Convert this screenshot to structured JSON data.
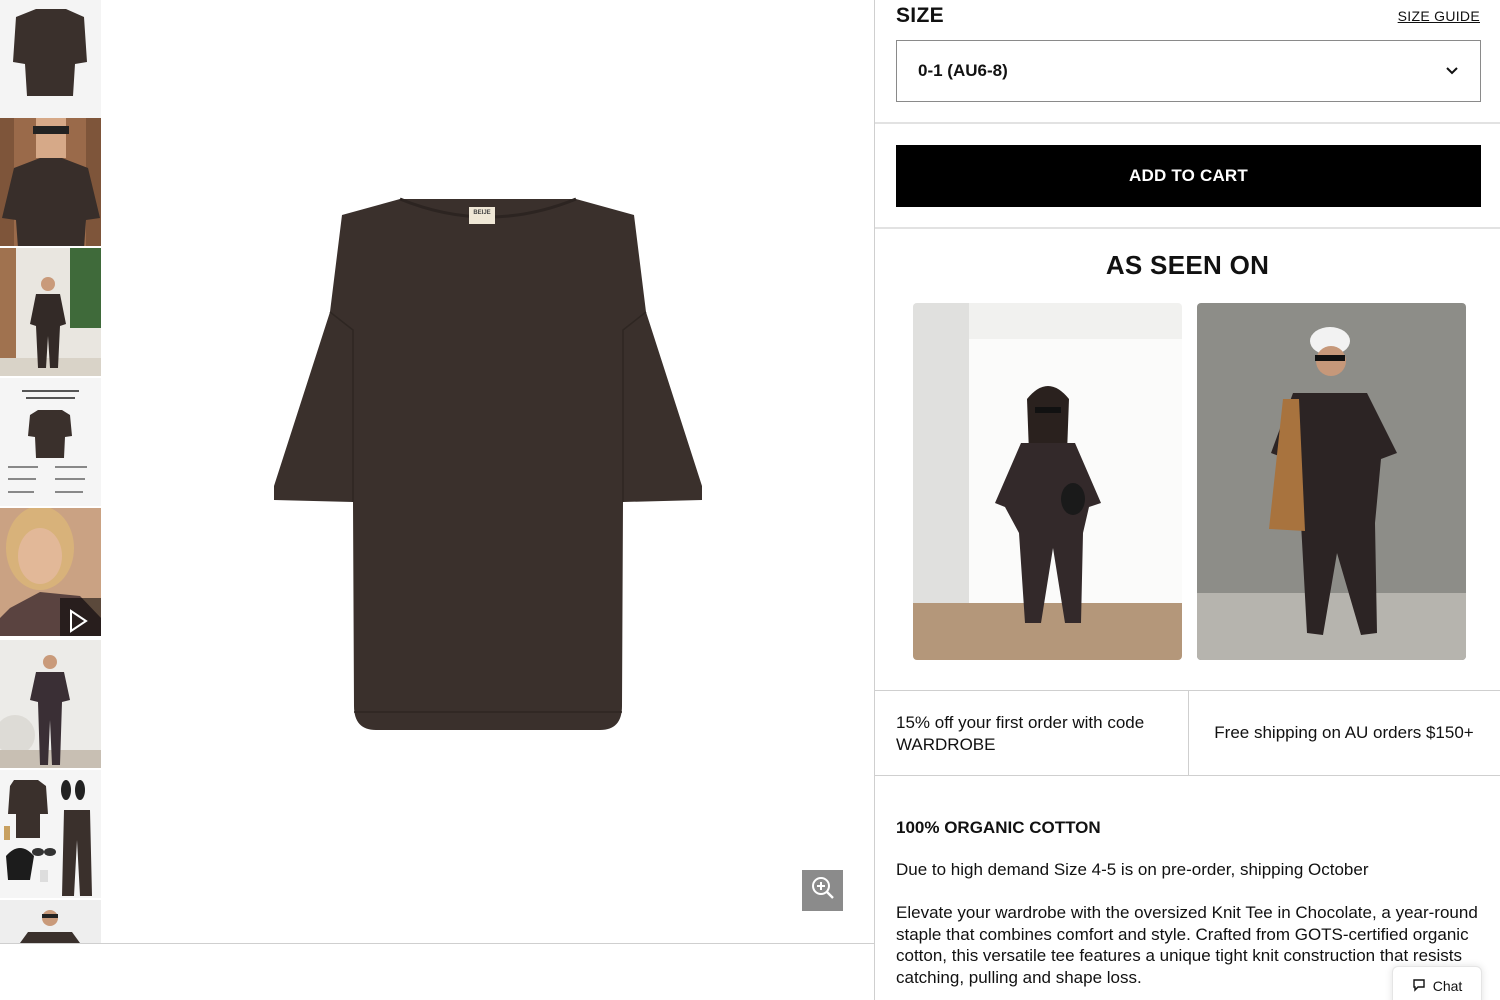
{
  "gallery": {
    "thumbnails": [
      {
        "name": "thumb-product-front"
      },
      {
        "name": "thumb-model-closeup"
      },
      {
        "name": "thumb-model-outdoor"
      },
      {
        "name": "thumb-info-card",
        "text": "You'll never go back to synthetic clothing."
      },
      {
        "name": "thumb-video"
      },
      {
        "name": "thumb-model-studio"
      },
      {
        "name": "thumb-flatlay"
      },
      {
        "name": "thumb-model-partial"
      }
    ],
    "main_image_label": "BEIJE",
    "zoom_icon": "zoom-in-icon"
  },
  "size": {
    "label": "SIZE",
    "guide_label": "SIZE GUIDE",
    "selected": "0-1 (AU6-8)"
  },
  "cart": {
    "add_label": "ADD TO CART"
  },
  "seen_on": {
    "title": "AS SEEN ON"
  },
  "promos": {
    "left": "15% off your first order with code WARDROBE",
    "right": "Free shipping on AU orders $150+"
  },
  "description": {
    "heading": "100% ORGANIC COTTON",
    "notice": "Due to high demand Size 4-5 is on pre-order, shipping October",
    "body": "Elevate your wardrobe with the oversized Knit Tee in Chocolate, a year-round staple that combines comfort and style. Crafted from GOTS-certified organic cotton, this versatile tee features a unique tight knit construction that resists catching, pulling and shape loss."
  },
  "chat": {
    "label": "Chat"
  },
  "colors": {
    "product": "#3a302c",
    "cart_bg": "#000000"
  }
}
